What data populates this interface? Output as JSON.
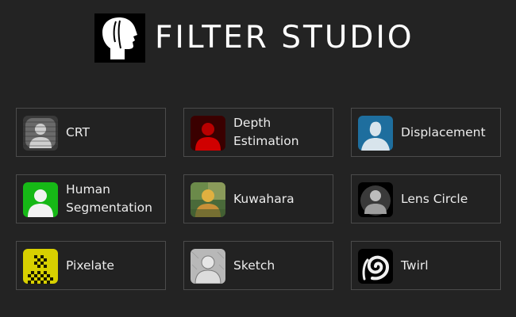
{
  "header": {
    "title": "FILTER STUDIO",
    "logo_icon": "human-head-profile-icon"
  },
  "filters": [
    {
      "label": "CRT",
      "icon": "crt-filter-icon"
    },
    {
      "label": "Depth\nEstimation",
      "icon": "depth-estimation-icon"
    },
    {
      "label": "Displacement",
      "icon": "displacement-icon"
    },
    {
      "label": "Human\nSegmentation",
      "icon": "human-segmentation-icon"
    },
    {
      "label": "Kuwahara",
      "icon": "kuwahara-icon"
    },
    {
      "label": "Lens Circle",
      "icon": "lens-circle-icon"
    },
    {
      "label": "Pixelate",
      "icon": "pixelate-icon"
    },
    {
      "label": "Sketch",
      "icon": "sketch-icon"
    },
    {
      "label": "Twirl",
      "icon": "twirl-icon"
    }
  ],
  "colors": {
    "background": "#232323",
    "card_border": "#4b4b4b",
    "text": "#ececec"
  }
}
